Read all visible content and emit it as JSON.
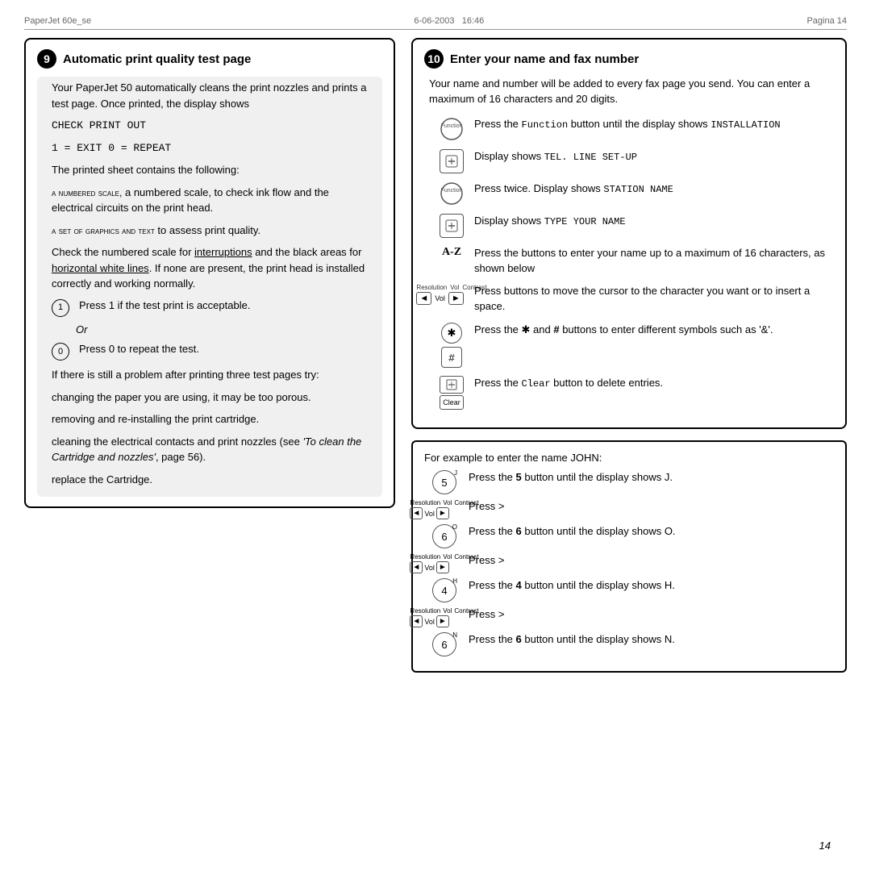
{
  "header": {
    "left": "PaperJet 60e_se",
    "center_date": "6-06-2003",
    "center_time": "16:46",
    "right": "Pagina 14"
  },
  "page_number": "14",
  "section_left": {
    "number": "9",
    "title": "Automatic print quality test page",
    "para1": "Your PaperJet 50 automatically cleans the print nozzles and prints a test page. Once printed, the display shows",
    "code1": "CHECK PRINT OUT",
    "code2": "1 = EXIT 0 = REPEAT",
    "para2": "The printed sheet contains the following:",
    "item1": "a numbered scale, to check ink flow and the electrical circuits on the print head.",
    "item2": "a set of graphics and text to assess print quality.",
    "para3": "Check the numbered scale for interruptions and the black areas for horizontal white lines. If none are present, the print head is installed correctly and working normally.",
    "press1_btn": "1",
    "press1_text": "Press 1 if the test print is acceptable.",
    "or_text": "Or",
    "press0_btn": "0",
    "press0_text": "Press 0 to repeat the test.",
    "para4": "If there is still a problem after printing three test pages try:",
    "bullet1": "changing the paper you are using, it may be too porous.",
    "bullet2": "removing and re-installing the print cartridge.",
    "bullet3": "cleaning the electrical contacts and print nozzles (see 'To clean the Cartridge and nozzles', page 56).",
    "bullet4": "replace the Cartridge."
  },
  "section_right": {
    "number": "10",
    "title": "Enter your name and fax number",
    "intro": "Your name and number will be added to every fax page you send. You can enter a maximum of 16 characters and 20 digits.",
    "row1_text": "Press the Function button until the display shows  INSTALLATION",
    "row2_text": "Display shows  TEL. LINE SET-UP",
    "row3_text": "Press twice. Display shows  STATION NAME",
    "row4_text": "Display shows  TYPE YOUR NAME",
    "row5_label": "A-Z",
    "row5_text": "Press the buttons to enter your name up to a maximum of 16 characters, as shown below",
    "row6_labels": [
      "Resolution",
      "Vol",
      "Contrast"
    ],
    "row6_text": "Press buttons to move the cursor to the character you want or to insert a space.",
    "row7_text": "Press the     and # buttons to enter different symbols such as '&'.",
    "row8_text": "Press the Clear button to delete entries."
  },
  "example_box": {
    "intro": "For example to enter the name JOHN:",
    "row1_btn": "5",
    "row1_text": "Press the 5 button until the display shows J.",
    "row2_text": "Press >",
    "row3_btn": "6",
    "row3_text": "Press the 6 button until the display shows O.",
    "row4_text": "Press >",
    "row5_btn": "4",
    "row5_text": "Press the 4 button until the display shows H.",
    "row6_text": "Press >",
    "row7_btn": "6",
    "row7_text": "Press the 6 button until the display shows N."
  }
}
